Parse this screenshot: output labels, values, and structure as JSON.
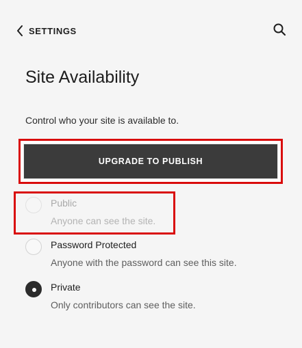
{
  "header": {
    "back_label": "SETTINGS",
    "back_icon": "chevron-left-icon",
    "search_icon": "search-icon"
  },
  "page": {
    "title": "Site Availability",
    "description": "Control who your site is available to."
  },
  "upgrade": {
    "label": "UPGRADE TO PUBLISH"
  },
  "options": [
    {
      "label": "Public",
      "description": "Anyone can see the site.",
      "selected": false,
      "disabled": true
    },
    {
      "label": "Password Protected",
      "description": "Anyone with the password can see this site.",
      "selected": false,
      "disabled": false
    },
    {
      "label": "Private",
      "description": "Only contributors can see the site.",
      "selected": true,
      "disabled": false
    }
  ],
  "colors": {
    "background": "#f5f5f5",
    "button": "#3b3b3b",
    "highlight": "#d90b0b"
  }
}
